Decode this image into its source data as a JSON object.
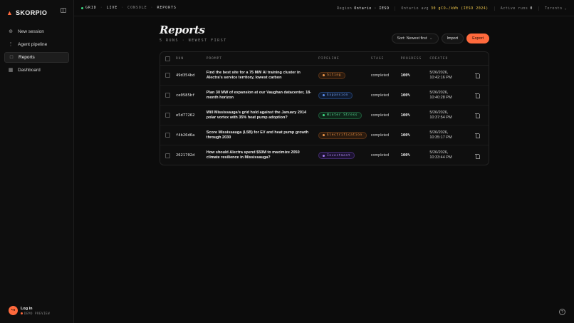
{
  "brand": {
    "name": "SKORPIO",
    "accent": "#ff6a3d"
  },
  "sidebar": {
    "items": [
      {
        "label": "New session",
        "icon": "plus-circle-icon"
      },
      {
        "label": "Agent pipeline",
        "icon": "branch-icon"
      },
      {
        "label": "Reports",
        "icon": "document-icon",
        "active": true
      },
      {
        "label": "Dashboard",
        "icon": "grid-icon"
      }
    ],
    "login": {
      "title": "Log in",
      "subtitle": "DEMO PREVIEW"
    }
  },
  "topbar": {
    "crumbs": [
      "GRID",
      "LIVE",
      "CONSOLE",
      "REPORTS"
    ],
    "region_label": "Region",
    "region_value": "Ontario · IESO",
    "avg_label": "Ontario avg",
    "avg_value": "30 gCO₂/kWh (IESO 2024)",
    "runs_label": "Active runs",
    "runs_value": "0",
    "city": "Toronto"
  },
  "page": {
    "title": "Reports",
    "subtitle": "5 RUNS · NEWEST FIRST",
    "sort_label": "Sort: Newest first",
    "import_label": "Import",
    "export_label": "Export"
  },
  "table": {
    "headers": {
      "run": "RUN",
      "prompt": "PROMPT",
      "pipeline": "PIPELINE",
      "stage": "STAGE",
      "progress": "PROGRESS",
      "created": "CREATED"
    },
    "rows": [
      {
        "run": "49d354bd",
        "prompt": "Find the best site for a 75 MW AI training cluster in Alectra's service territory, lowest carbon",
        "pipeline": "Siting",
        "pipeline_color": "#f2994a",
        "stage": "completed",
        "progress": "100%",
        "created_date": "5/26/2026,",
        "created_time": "10:42:16 PM"
      },
      {
        "run": "ce0585bf",
        "prompt": "Plan 30 MW of expansion at our Vaughan datacenter, 18-month horizon",
        "pipeline": "Expansion",
        "pipeline_color": "#5b8def",
        "stage": "completed",
        "progress": "100%",
        "created_date": "5/26/2026,",
        "created_time": "10:40:28 PM"
      },
      {
        "run": "e5d77262",
        "prompt": "Will Mississauga's grid hold against the January 2014 polar vortex with 35% heat pump adoption?",
        "pipeline": "Winter Stress",
        "pipeline_color": "#3ddc84",
        "stage": "completed",
        "progress": "100%",
        "created_date": "5/26/2026,",
        "created_time": "10:37:54 PM"
      },
      {
        "run": "f4b26d6a",
        "prompt": "Score Mississauga (L5B) for EV and heat pump growth through 2030",
        "pipeline": "Electrification",
        "pipeline_color": "#f2994a",
        "stage": "completed",
        "progress": "100%",
        "created_date": "5/26/2026,",
        "created_time": "10:35:17 PM"
      },
      {
        "run": "2621702d",
        "prompt": "How should Alectra spend $50M to maximize 2050 climate resilience in Mississauga?",
        "pipeline": "Investment",
        "pipeline_color": "#a77bf3",
        "stage": "completed",
        "progress": "100%",
        "created_date": "5/26/2026,",
        "created_time": "10:33:44 PM"
      }
    ]
  }
}
